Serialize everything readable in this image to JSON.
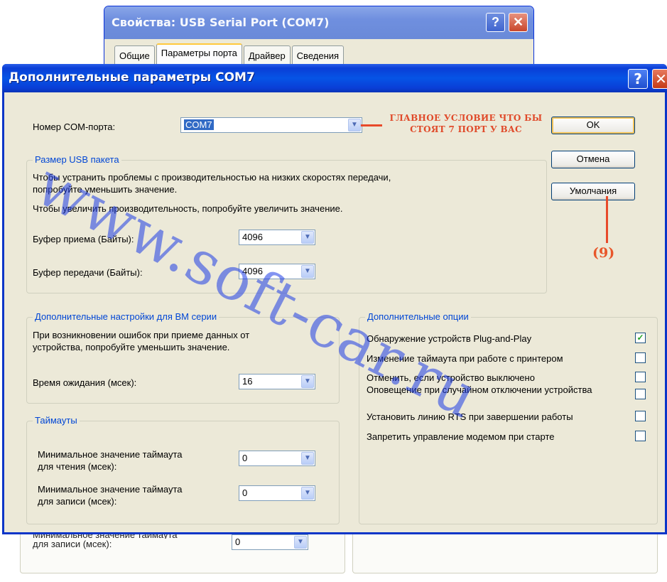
{
  "background_window": {
    "title": "Свойства: USB Serial Port (COM7)",
    "help_label": "?",
    "close_label": "✕",
    "tabs": [
      "Общие",
      "Параметры порта",
      "Драйвер",
      "Сведения"
    ],
    "lower_label_cut": "Минимальное значение таймаута",
    "lower_label": "для записи (мсек):",
    "lower_value": "0"
  },
  "dialog": {
    "title": "Дополнительные параметры COM7",
    "help_label": "?",
    "close_label": "✕",
    "com_port": {
      "label": "Номер COM-порта:",
      "value": "COM7"
    },
    "usb_group": {
      "title": "Размер USB пакета",
      "desc1": "Чтобы устранить проблемы с производительностью на низких скоростях передачи,",
      "desc2": "попробуйте уменьшить значение.",
      "desc3": "Чтобы увеличить производительность, попробуйте увеличить значение.",
      "rx_label": "Буфер приема (Байты):",
      "rx_value": "4096",
      "tx_label": "Буфер передачи (Байты):",
      "tx_value": "4096"
    },
    "bm_group": {
      "title": "Дополнительные настройки для BM серии",
      "desc1": "При возникновении ошибок при приеме данных от",
      "desc2": "устройства, попробуйте уменьшить значение.",
      "latency_label": "Время ожидания (мсек):",
      "latency_value": "16"
    },
    "timeouts_group": {
      "title": "Таймауты",
      "read_label1": "Минимальное значение таймаута",
      "read_label2": "для чтения (мсек):",
      "read_value": "0",
      "write_label1": "Минимальное значение таймаута",
      "write_label2": "для записи (мсек):",
      "write_value": "0"
    },
    "options_group": {
      "title": "Дополнительные опции",
      "items": [
        {
          "label": "Обнаружение устройств Plug-and-Play",
          "checked": true
        },
        {
          "label": "Изменение таймаута при работе с принтером",
          "checked": false
        },
        {
          "label": "Отменить, если устройство выключено",
          "checked": false
        },
        {
          "label": "Оповещение при случайном отключении устройства",
          "checked": false
        },
        {
          "label": "Установить линию RTS при завершении работы",
          "checked": false
        },
        {
          "label": "Запретить управление модемом при старте",
          "checked": false
        }
      ]
    },
    "buttons": {
      "ok": "OK",
      "cancel": "Отмена",
      "defaults": "Умолчания"
    }
  },
  "annotation": {
    "line1": "ГЛАВНОЕ УСЛОВИЕ ЧТО БЫ",
    "line2": "СТОЯТ 7  ПОРТ У ВАС",
    "number": "(9)",
    "color": "#e04a2a"
  },
  "watermark": {
    "text": "www.soft-car.ru",
    "color": "#1e3ce6"
  },
  "icons": {
    "dropdown": "chevron-down-icon",
    "check": "check-icon"
  }
}
